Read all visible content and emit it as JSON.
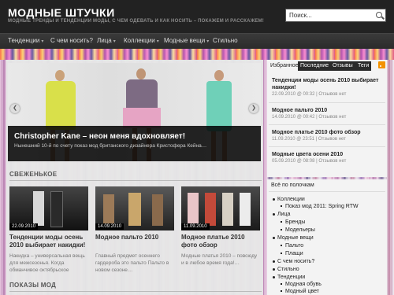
{
  "header": {
    "title": "МОДНЫЕ ШТУЧКИ",
    "tagline": "МОДНЫЕ ТРЕНДЫ И ТЕНДЕНЦИИ МОДЫ, С ЧЕМ ОДЕВАТЬ И КАК НОСИТЬ – ПОКАЖЕМ И РАССКАЖЕМ!",
    "search_placeholder": "Поиск..."
  },
  "nav": [
    {
      "label": "Тенденции",
      "has_submenu": true
    },
    {
      "label": "С чем носить?",
      "has_submenu": false
    },
    {
      "label": "Лица",
      "has_submenu": true
    },
    {
      "label": "Коллекции",
      "has_submenu": true
    },
    {
      "label": "Модные вещи",
      "has_submenu": true
    },
    {
      "label": "Стильно",
      "has_submenu": false
    }
  ],
  "slider": {
    "title": "Christopher Kane – неон меня вдохновляет!",
    "excerpt": "Нынешний 10-й по счету показ мод британского дизайнера Кристофера Кейна…",
    "prev_arrow": "❮",
    "next_arrow": "❯"
  },
  "fresh": {
    "heading": "СВЕЖЕНЬКОЕ",
    "cards": [
      {
        "date": "22.09.2010",
        "title": "Тенденции моды осень 2010 выбирает накидки!",
        "excerpt": "Накидка – универсальная вещь для межсезонья. Когда обманчивое октябрьское"
      },
      {
        "date": "14.09.2010",
        "title": "Модное пальто 2010",
        "excerpt": "Главный предмет осеннего гардероба это пальто Пальто в новом сезоне…"
      },
      {
        "date": "11.09.2010",
        "title": "Модное платье 2010 фото обзор",
        "excerpt": "Модные платья 2010 – повсюду и в любое время года!…"
      }
    ]
  },
  "shows_heading": "ПОКАЗЫ МОД",
  "sidebar": {
    "tabs": [
      "Избранное",
      "Последние",
      "Отзывы",
      "Теги"
    ],
    "posts": [
      {
        "title": "Тенденции моды осень 2010 выбирает накидки!",
        "meta": "22.09.2010 @ 00:32 | Отзывов нет"
      },
      {
        "title": "Модное пальто 2010",
        "meta": "14.09.2010 @ 00:42 | Отзывов нет"
      },
      {
        "title": "Модное платье 2010 фото обзор",
        "meta": "11.09.2010 @ 23:51 | Отзывов нет"
      },
      {
        "title": "Модные цвета осени 2010",
        "meta": "05.09.2010 @ 08:08 | Отзывов нет"
      }
    ],
    "categories_title": "Всё по полочкам",
    "categories": [
      {
        "label": "Коллекции",
        "level": 0
      },
      {
        "label": "Показ мод 2011: Spring RTW",
        "level": 1
      },
      {
        "label": "Лица",
        "level": 0
      },
      {
        "label": "Бренды",
        "level": 1
      },
      {
        "label": "Модельеры",
        "level": 1
      },
      {
        "label": "Модные вещи",
        "level": 0
      },
      {
        "label": "Пальто",
        "level": 1
      },
      {
        "label": "Плащи",
        "level": 1
      },
      {
        "label": "С чем носить?",
        "level": 0
      },
      {
        "label": "Стильно",
        "level": 0
      },
      {
        "label": "Тенденции",
        "level": 0
      },
      {
        "label": "Модная обувь",
        "level": 1
      },
      {
        "label": "Модный цвет",
        "level": 1
      }
    ]
  },
  "colors": {
    "rss": "#f39200",
    "header": "#222222",
    "nav": "#2f2f2f"
  }
}
